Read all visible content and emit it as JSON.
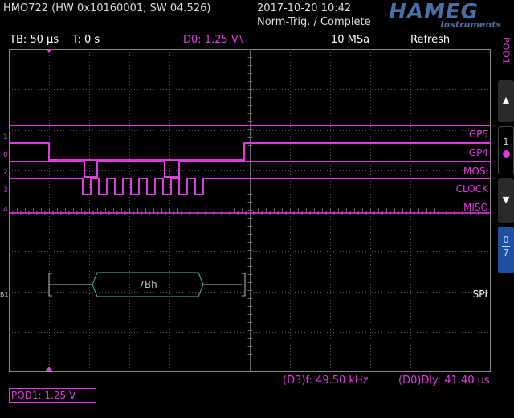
{
  "header": {
    "model": "HMO722 (HW 0x10160001; SW 04.526)",
    "datetime": "2017-10-20 10:42",
    "status": "Norm-Trig. / Complete",
    "logo": "HAMEG",
    "logo_sub": "Instruments"
  },
  "info_bar": {
    "timebase": "TB: 50 µs",
    "trigger_time": "T: 0 s",
    "trigger_channel": "D0: 1.25 V",
    "trigger_slope": "\\",
    "sample_rate": "10 MSa",
    "mode": "Refresh"
  },
  "channels": [
    {
      "number": "1",
      "name": "GP5"
    },
    {
      "number": "0",
      "name": "GP4"
    },
    {
      "number": "2",
      "name": "MOSI"
    },
    {
      "number": "3",
      "name": "CLOCK"
    },
    {
      "number": "4",
      "name": "MISO"
    }
  ],
  "bus": {
    "marker": "B1",
    "name": "SPI",
    "decoded_value": "7Bh"
  },
  "side_panel": {
    "pod_label": "POD1",
    "up_icon": "triangle-up-icon",
    "selected_number": "1",
    "down_icon": "triangle-down-icon",
    "range_top": "0",
    "range_bottom": "7"
  },
  "measurements": {
    "frequency": "(D3)f: 49.50 kHz",
    "delay": "(D0)Dly: 41.40 µs"
  },
  "footer": {
    "pod_threshold": "POD1: 1.25 V"
  },
  "colors": {
    "trace": "#e03ce0",
    "bus": "#4fb8a8",
    "grid": "#5a5a5a",
    "logo": "#4a6fa5",
    "side_panel": "#2b2b2b",
    "side_panel_active": "#1f4fa0"
  }
}
